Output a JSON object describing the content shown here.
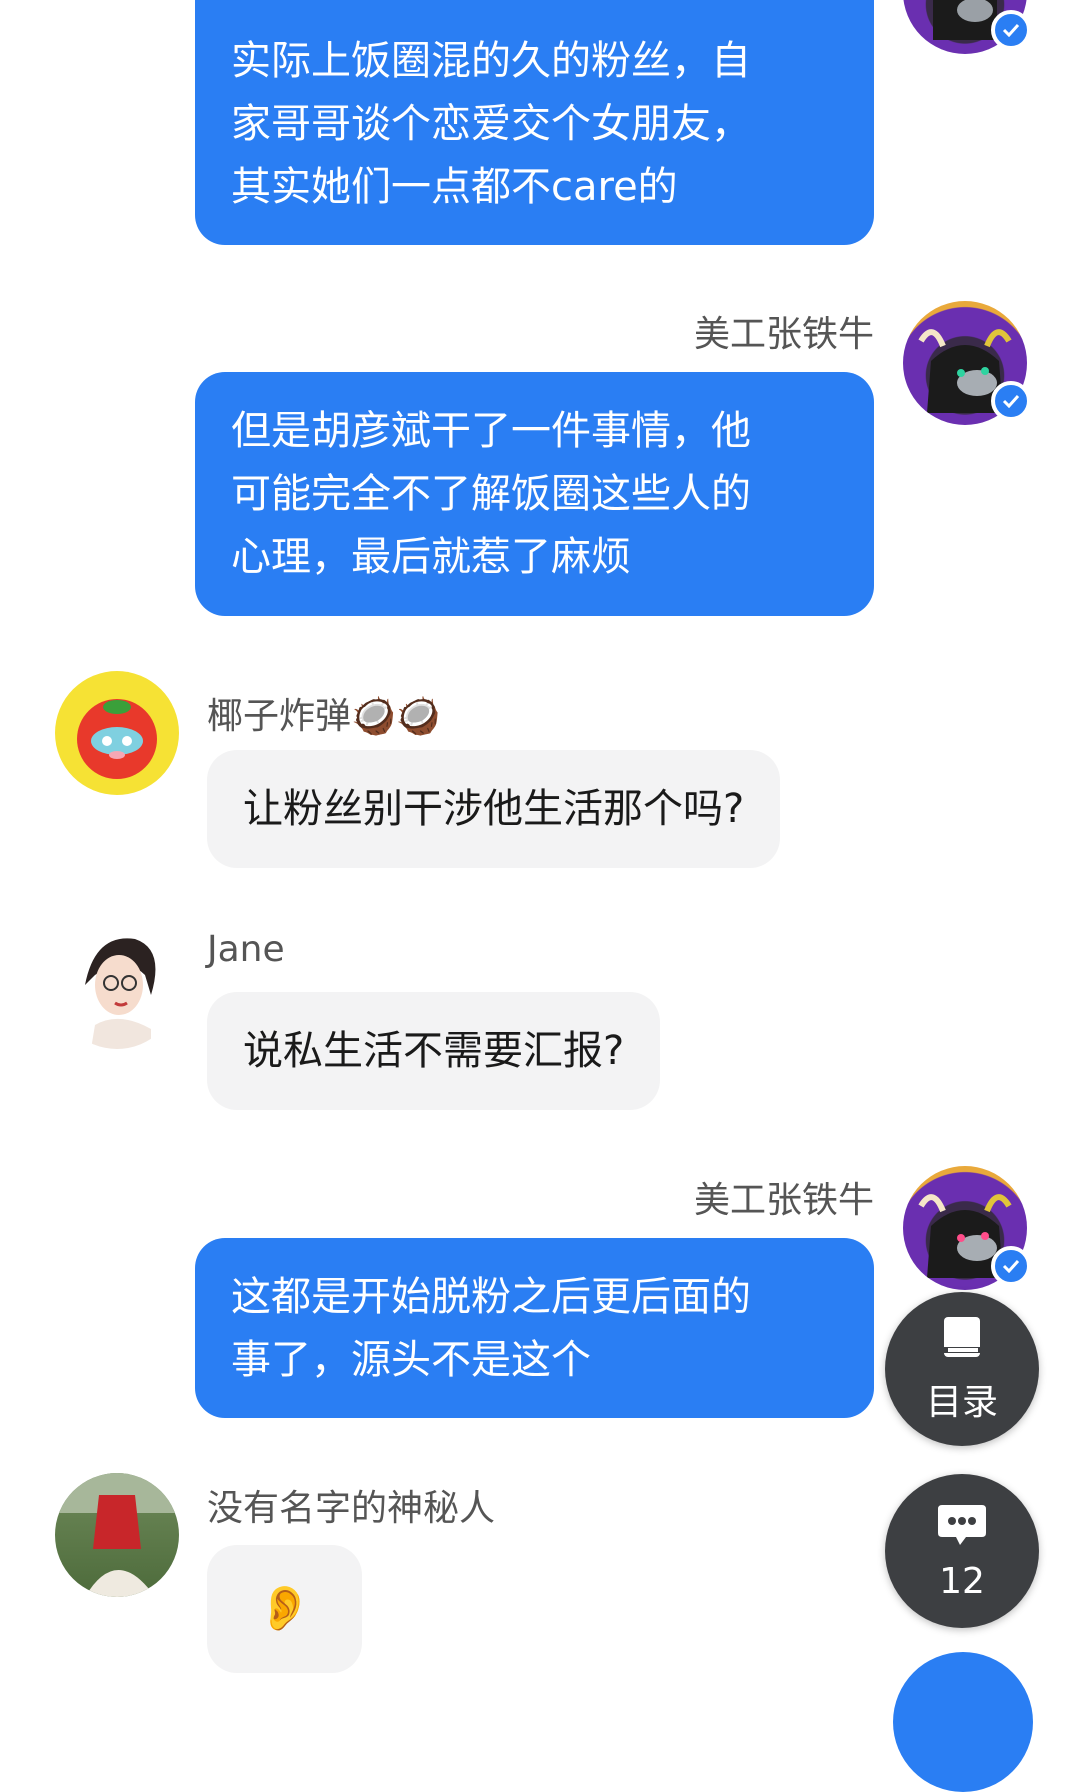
{
  "messages": [
    {
      "side": "right",
      "sender": "",
      "lines": [
        "实际上饭圈混的久的粉丝，自",
        "家哥哥谈个恋爱交个女朋友，",
        "其实她们一点都不care的"
      ]
    },
    {
      "side": "right",
      "sender": "美工张铁牛",
      "lines": [
        "但是胡彦斌干了一件事情，他",
        "可能完全不了解饭圈这些人的",
        "心理，最后就惹了麻烦"
      ]
    },
    {
      "side": "left",
      "sender": "椰子炸弹🥥🥥",
      "text": "让粉丝别干涉他生活那个吗?"
    },
    {
      "side": "left",
      "sender": "Jane",
      "text": "说私生活不需要汇报?"
    },
    {
      "side": "right",
      "sender": "美工张铁牛",
      "lines": [
        "这都是开始脱粉之后更后面的",
        "事了，源头不是这个"
      ]
    },
    {
      "side": "left",
      "sender": "没有名字的神秘人",
      "text": "👂"
    }
  ],
  "fabs": {
    "catalog": {
      "icon": "book-icon",
      "label": "目录"
    },
    "comments": {
      "icon": "comment-icon",
      "label": "12"
    }
  },
  "colors": {
    "accent": "#2a7ef3",
    "incoming_bubble": "#f3f3f4",
    "fab": "#3d3f42"
  }
}
